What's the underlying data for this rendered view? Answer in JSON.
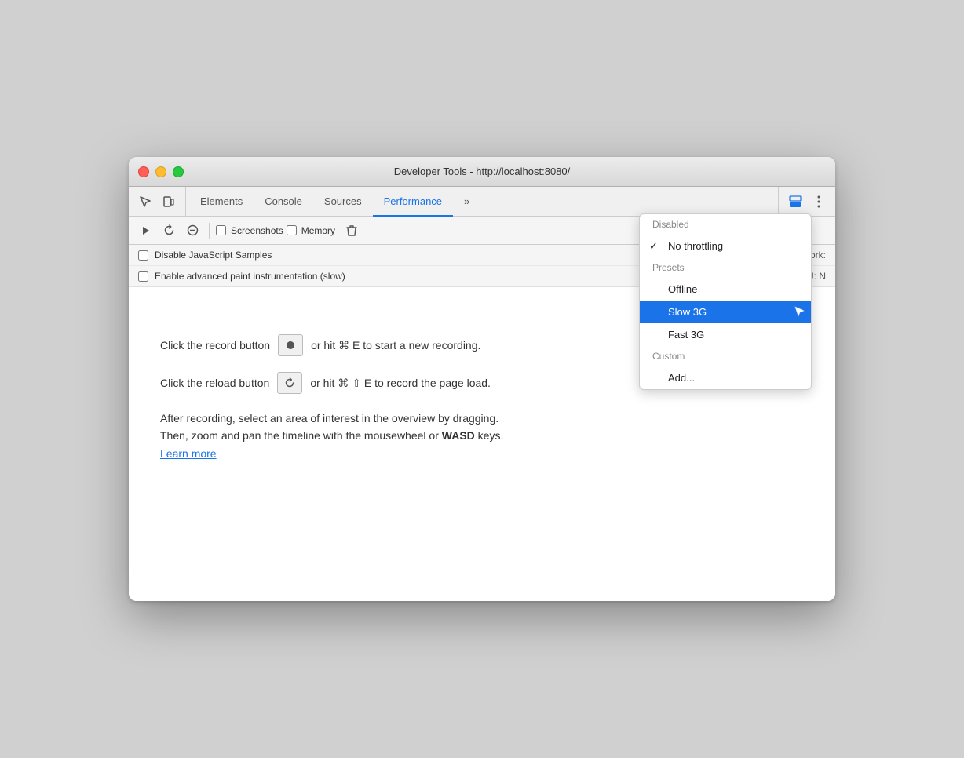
{
  "window": {
    "title": "Developer Tools - http://localhost:8080/"
  },
  "tabs": {
    "items": [
      {
        "id": "elements",
        "label": "Elements",
        "active": false
      },
      {
        "id": "console",
        "label": "Console",
        "active": false
      },
      {
        "id": "sources",
        "label": "Sources",
        "active": false
      },
      {
        "id": "performance",
        "label": "Performance",
        "active": true
      },
      {
        "id": "more",
        "label": "»",
        "active": false
      }
    ]
  },
  "toolbar": {
    "screenshots_label": "Screenshots",
    "memory_label": "Memory"
  },
  "options": {
    "disable_js_label": "Disable JavaScript Samples",
    "network_label": "Network:",
    "advanced_paint_label": "Enable advanced paint instrumentation (slow)",
    "cpu_label": "CPU:  N"
  },
  "dropdown": {
    "items": [
      {
        "id": "disabled",
        "label": "Disabled",
        "type": "section-header"
      },
      {
        "id": "no-throttling",
        "label": "No throttling",
        "checked": true,
        "type": "item"
      },
      {
        "id": "presets",
        "label": "Presets",
        "type": "section-header"
      },
      {
        "id": "offline",
        "label": "Offline",
        "type": "item"
      },
      {
        "id": "slow-3g",
        "label": "Slow 3G",
        "selected": true,
        "type": "item"
      },
      {
        "id": "fast-3g",
        "label": "Fast 3G",
        "type": "item"
      },
      {
        "id": "custom",
        "label": "Custom",
        "type": "section-header"
      },
      {
        "id": "add",
        "label": "Add...",
        "type": "item"
      }
    ]
  },
  "main_content": {
    "record_instruction": "Click the record button",
    "record_shortcut": "or hit ⌘ E to start a new recording.",
    "reload_instruction": "Click the reload button",
    "reload_shortcut": "or hit ⌘ ⇧ E to record the page load.",
    "description": "After recording, select an area of interest in the overview by dragging.\nThen, zoom and pan the timeline with the mousewheel or WASD keys.",
    "wasd": "WASD",
    "learn_more": "Learn more"
  }
}
